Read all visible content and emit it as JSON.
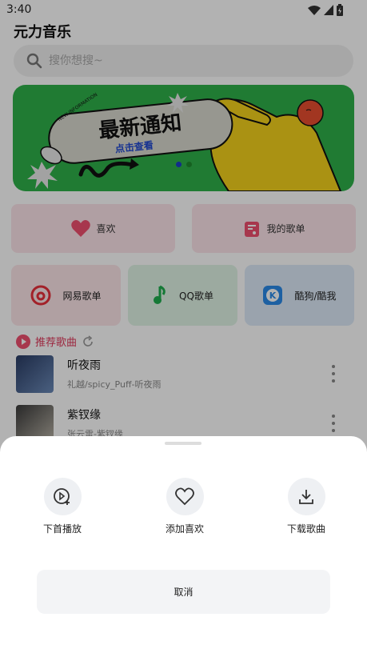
{
  "status": {
    "time": "3:40"
  },
  "app": {
    "title": "元力音乐"
  },
  "search": {
    "placeholder": "搜你想搜~"
  },
  "banner": {
    "headline": "最新通知",
    "sub": "点击查看",
    "tag": "NEW INFORMATION"
  },
  "quick": [
    {
      "label": "喜欢",
      "icon": "heart-icon"
    },
    {
      "label": "我的歌单",
      "icon": "playlist-icon"
    }
  ],
  "sources": [
    {
      "label": "网易歌单",
      "icon": "netease-icon"
    },
    {
      "label": "QQ歌单",
      "icon": "qqmusic-icon"
    },
    {
      "label": "酷狗/酷我",
      "icon": "kugou-icon"
    }
  ],
  "section": {
    "title": "推荐歌曲"
  },
  "songs": [
    {
      "title": "听夜雨",
      "artist": "礼越/spicy_Puff-听夜雨"
    },
    {
      "title": "紫钗缘",
      "artist": "张云雷-紫钗缘"
    }
  ],
  "sheet": {
    "actions": [
      {
        "label": "下首播放"
      },
      {
        "label": "添加喜欢"
      },
      {
        "label": "下载歌曲"
      }
    ],
    "cancel": "取消"
  }
}
